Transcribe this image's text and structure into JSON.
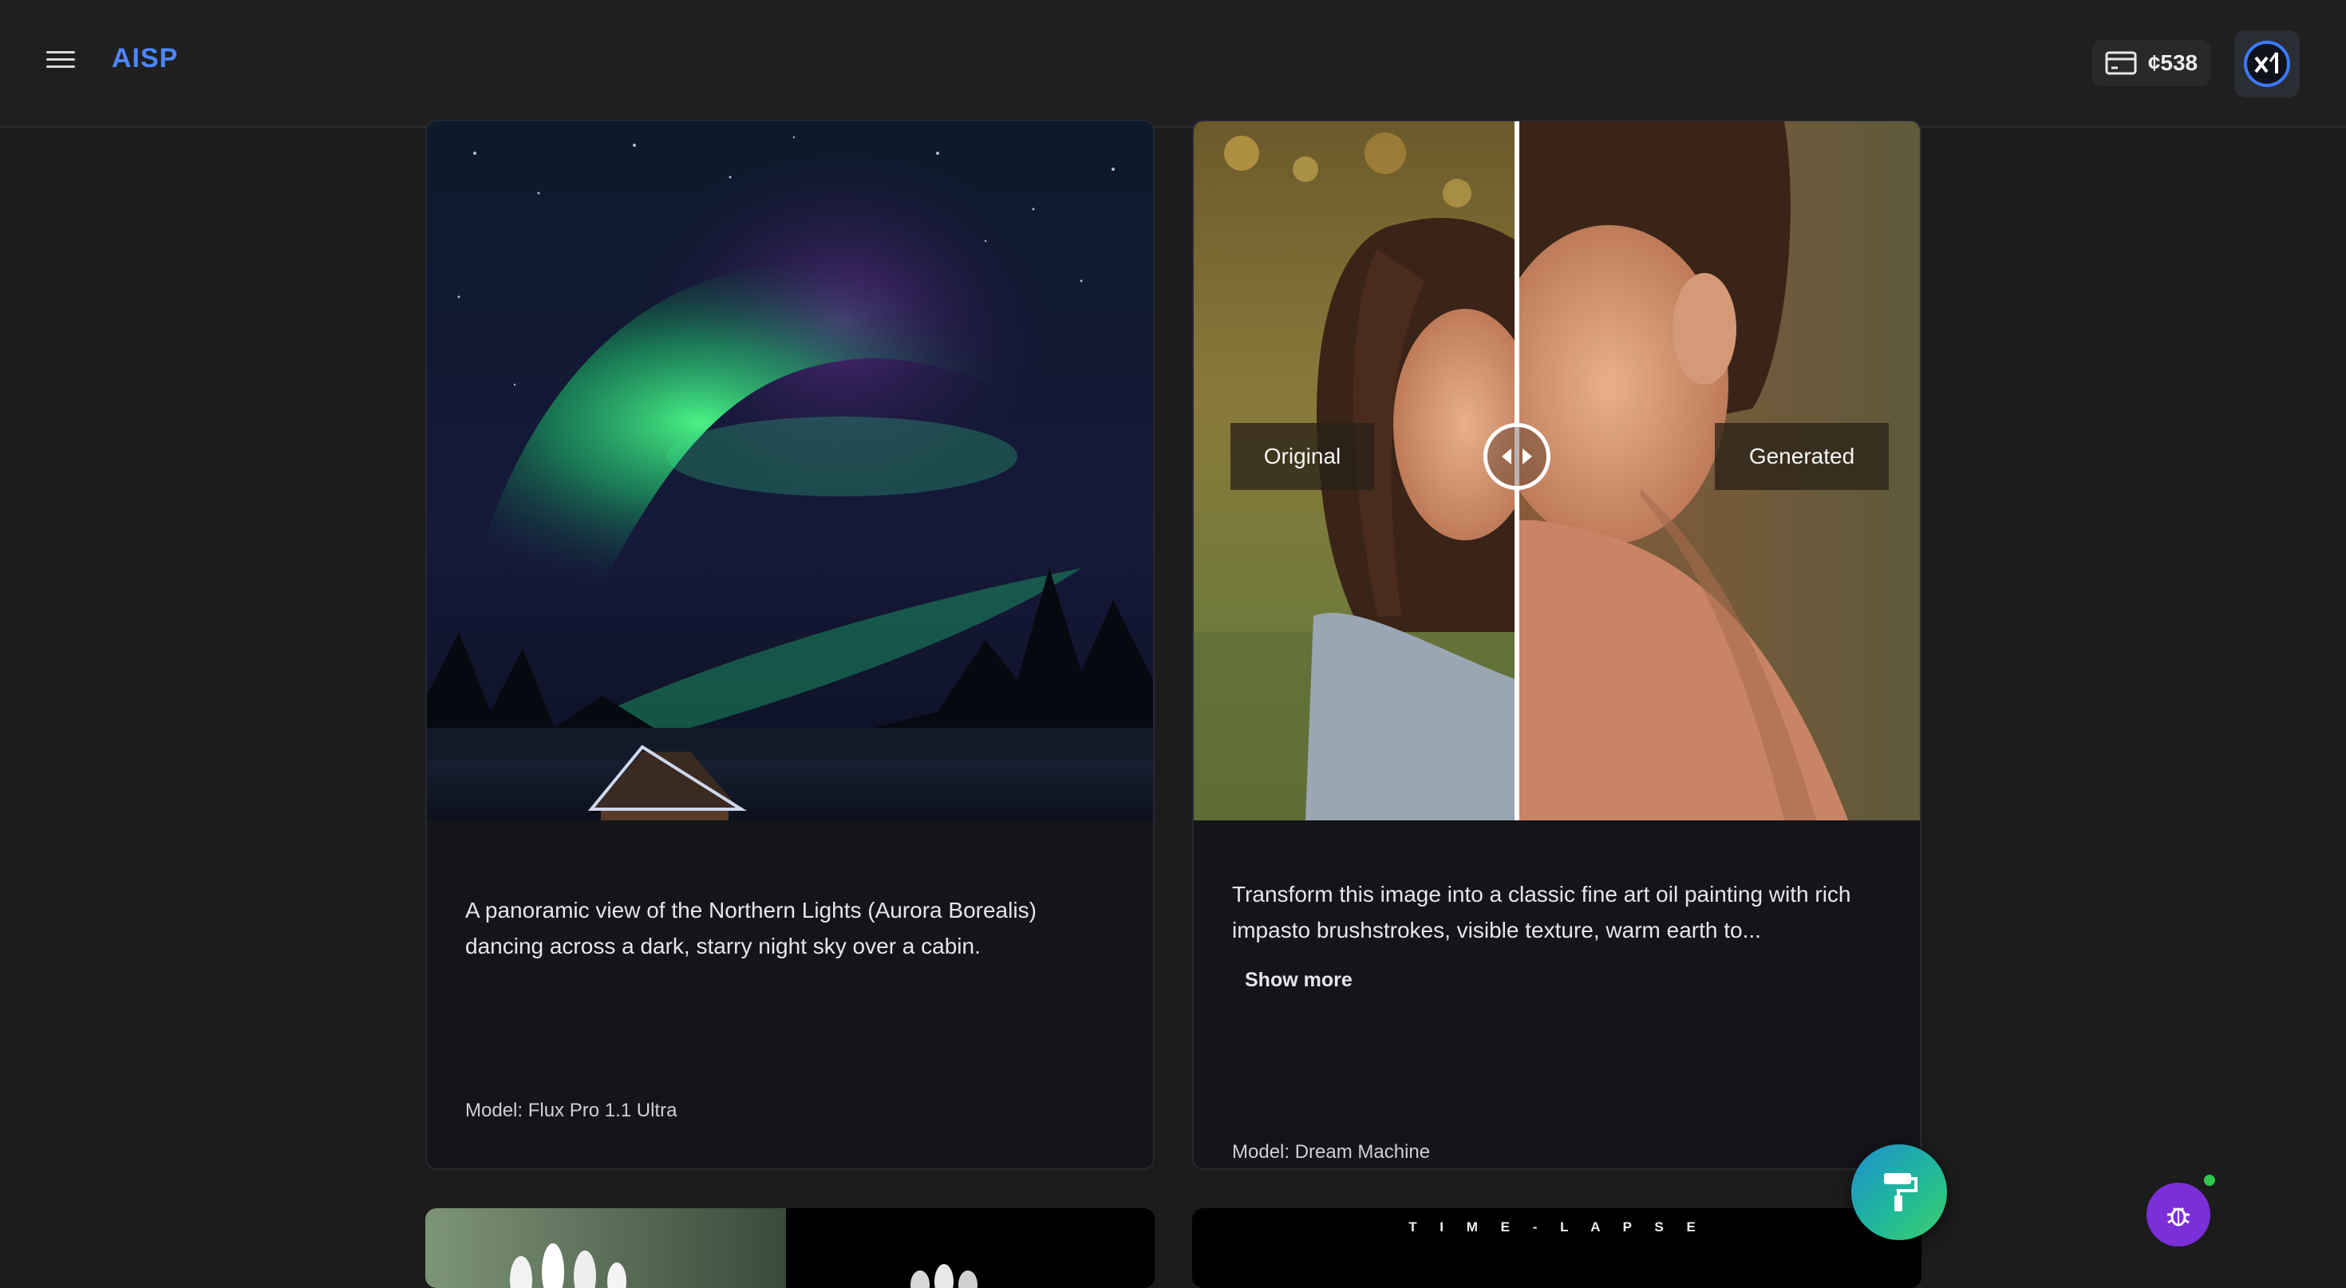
{
  "header": {
    "brand": "AISP",
    "credits": "¢538",
    "icons": {
      "menu": "hamburger-menu-icon",
      "credits": "wallet-card-icon",
      "avatar": "xai-logo-icon"
    }
  },
  "cards": [
    {
      "image": "aurora-over-cabin-photo",
      "description": "A panoramic view of the Northern Lights (Aurora Borealis) dancing across a dark, starry night sky over a cabin.",
      "model": "Model: Flux Pro 1.1 Ultra",
      "actions": [
        "regenerate-icon",
        "download-icon",
        "send-icon",
        "more-icon"
      ]
    },
    {
      "image": "portrait-before-after-comparison",
      "compare": {
        "left_label": "Original",
        "right_label": "Generated",
        "split_fraction": 0.45
      },
      "description": "Transform this image into a classic fine art oil painting with rich impasto brushstrokes, visible texture, warm earth to...",
      "show_more": "Show more",
      "model": "Model: Dream Machine",
      "actions": [
        "regenerate-icon",
        "download-icon",
        "send-icon",
        "more-icon"
      ]
    }
  ],
  "next_row": {
    "right_overlay_text": "T I M E - L A P S E"
  },
  "fab": {
    "paint": "paint-roller-icon",
    "bug": "bug-report-icon"
  }
}
